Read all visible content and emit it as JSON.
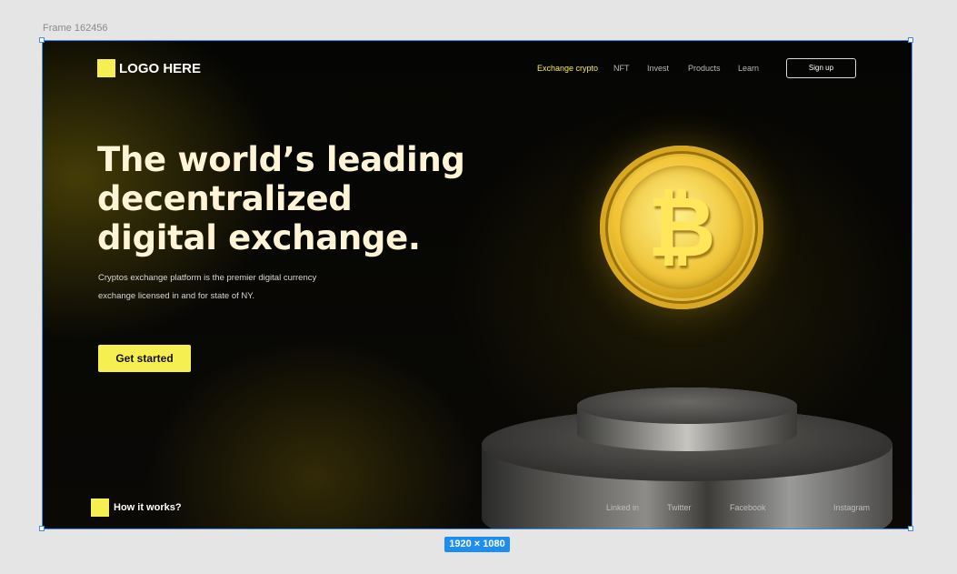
{
  "frame_label": "Frame 162456",
  "size_badge": "1920 × 1080",
  "logo": {
    "text": "LOGO HERE"
  },
  "nav": {
    "items": [
      {
        "label": "Exchange crypto",
        "active": true
      },
      {
        "label": "NFT"
      },
      {
        "label": "Invest"
      },
      {
        "label": "Products"
      },
      {
        "label": "Learn"
      }
    ],
    "signup_label": "Sign up"
  },
  "hero": {
    "headline_lines": [
      "The world’s leading",
      "decentralized",
      "digital exchange."
    ],
    "subtext_lines": [
      "Cryptos exchange platform is the premier digital currency",
      "exchange licensed in and for state of NY."
    ],
    "cta_label": "Get started"
  },
  "footer": {
    "how_label": "How it works?",
    "social": [
      "Linked in",
      "Twitter",
      "Facebook",
      "Instagram"
    ]
  },
  "colors": {
    "accent": "#f5ef52",
    "background": "#050503",
    "selection": "#3a8ee6"
  },
  "icons": {
    "coin": "bitcoin-coin-icon",
    "symbol": "₿"
  }
}
